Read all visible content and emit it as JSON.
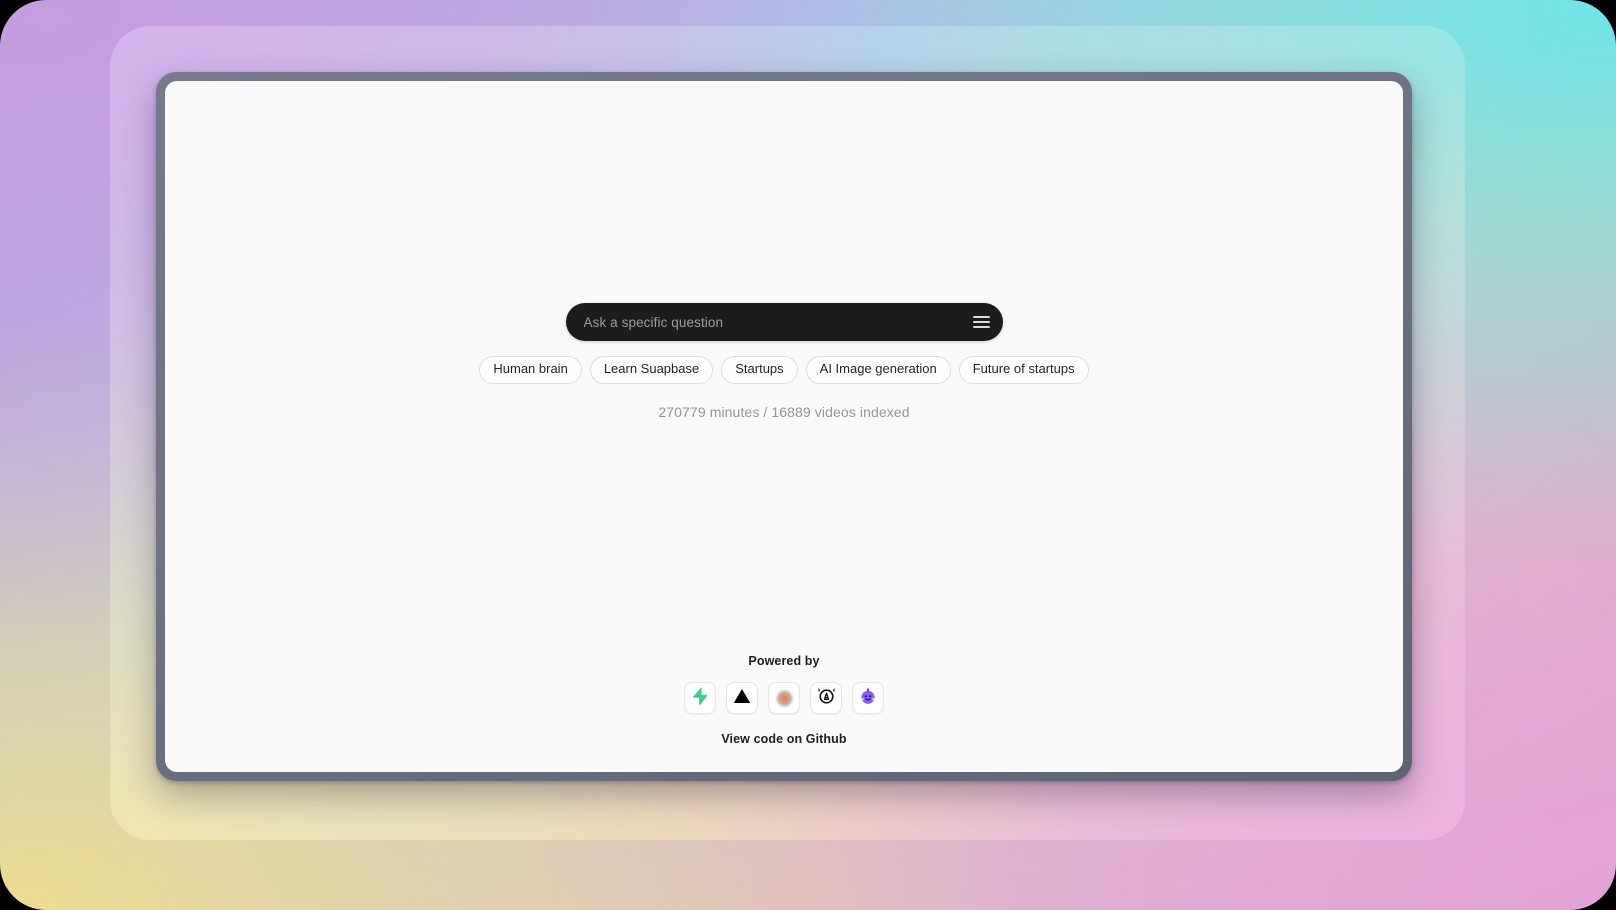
{
  "app": {
    "search": {
      "placeholder": "Ask a specific question",
      "value": "",
      "menu_icon": "hamburger-menu-icon"
    },
    "suggestions": [
      {
        "label": "Human brain"
      },
      {
        "label": "Learn Suapbase"
      },
      {
        "label": "Startups"
      },
      {
        "label": "AI Image generation"
      },
      {
        "label": "Future of startups"
      }
    ],
    "stats": "270779 minutes / 16889 videos indexed",
    "footer": {
      "powered_by_label": "Powered by",
      "logos": [
        {
          "name": "supabase-logo-icon",
          "title": "Supabase"
        },
        {
          "name": "vercel-logo-icon",
          "title": "Vercel"
        },
        {
          "name": "blurred-orb-logo-icon",
          "title": "Logo"
        },
        {
          "name": "mistral-devil-logo-icon",
          "title": "Devil Face"
        },
        {
          "name": "huggingface-logo-icon",
          "title": "Hugging Face"
        }
      ],
      "github_link_label": "View code on Github"
    }
  },
  "theme": {
    "search_bar_bg": "#1c1c1c",
    "screen_bg": "#fafafa",
    "chip_border": "#dcdfe4",
    "stats_color": "#9096a3",
    "device_frame": "#6d7382",
    "gradient_top_left": "#c79de0",
    "gradient_top_right": "#6fe6e8",
    "gradient_bottom_left": "#f0dd95",
    "gradient_bottom_right": "#e5a3d8"
  }
}
